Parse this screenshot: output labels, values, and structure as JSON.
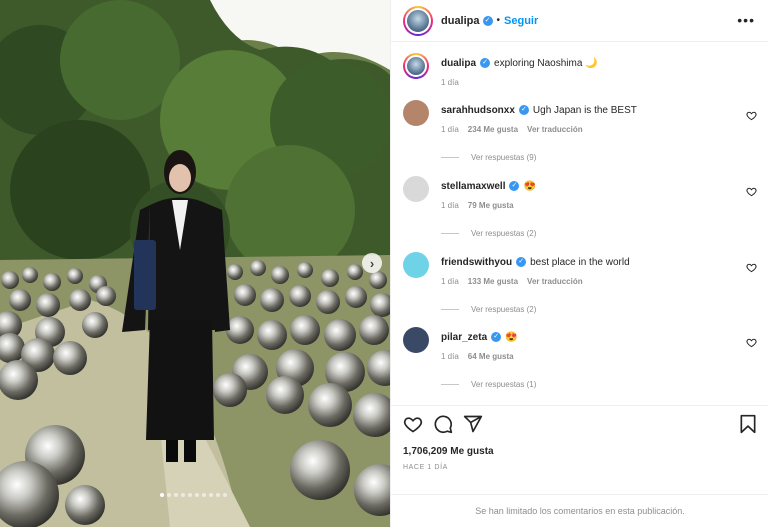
{
  "post": {
    "username": "dualipa",
    "follow_label": "Seguir",
    "more_label": "•••",
    "next_arrow": "›",
    "carousel_count": 10,
    "carousel_active": 0
  },
  "caption": {
    "username": "dualipa",
    "text": "exploring Naoshima 🌙",
    "time": "1 día"
  },
  "comments": [
    {
      "username": "sarahhudsonxx",
      "verified": true,
      "text": "Ugh Japan is the BEST",
      "time": "1 día",
      "likes": "234 Me gusta",
      "translate": "Ver traducción",
      "replies": "Ver respuestas (9)",
      "avatar_color": "#b4856a"
    },
    {
      "username": "stellamaxwell",
      "verified": true,
      "text": "😍",
      "time": "1 día",
      "likes": "79 Me gusta",
      "translate": "",
      "replies": "Ver respuestas (2)",
      "avatar_color": "#d9d9d9"
    },
    {
      "username": "friendswithyou",
      "verified": true,
      "text": "best place in the world",
      "time": "1 día",
      "likes": "133 Me gusta",
      "translate": "Ver traducción",
      "replies": "Ver respuestas (2)",
      "avatar_color": "#6fd3e8"
    },
    {
      "username": "pilar_zeta",
      "verified": true,
      "text": "😍",
      "time": "1 día",
      "likes": "64 Me gusta",
      "translate": "",
      "replies": "Ver respuestas (1)",
      "avatar_color": "#3a4a66"
    }
  ],
  "footer": {
    "likes": "1,706,209 Me gusta",
    "ago": "HACE 1 DÍA",
    "limited_notice": "Se han limitado los comentarios en esta publicación."
  },
  "icons": {
    "like": "heart-icon",
    "comment": "comment-icon",
    "share": "share-icon",
    "save": "bookmark-icon"
  },
  "colors": {
    "accent": "#0095f6",
    "verified": "#3897f0",
    "muted": "#8e8e8e"
  }
}
